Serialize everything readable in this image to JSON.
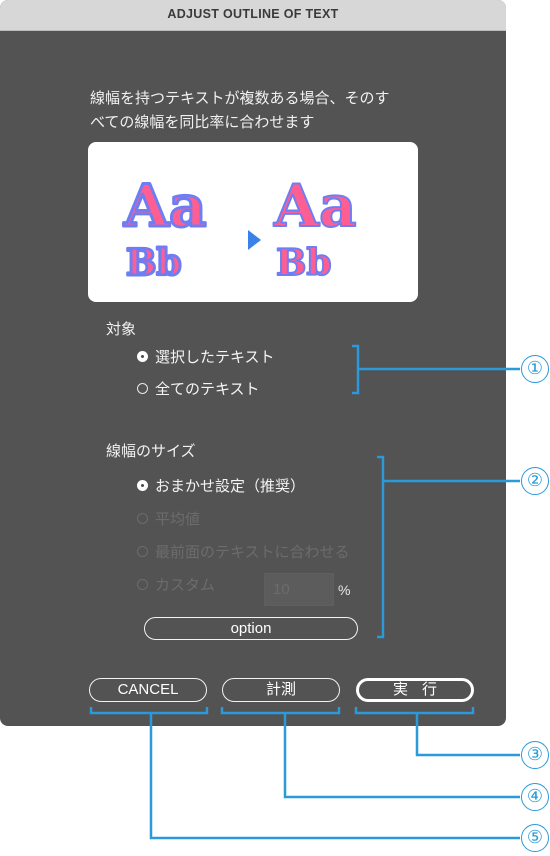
{
  "dialog": {
    "title": "ADJUST OUTLINE OF TEXT",
    "description_lines": [
      "線幅を持つテキストが複数ある場合、そのす",
      "べての線幅を同比率に合わせます"
    ],
    "preview": {
      "before": {
        "large": "Aa",
        "small": "Bb"
      },
      "after": {
        "large": "Aa",
        "small": "Bb"
      },
      "arrow_icon": "triangle-right",
      "fill_color": "#ff5e93",
      "stroke_color": "#6f7df2",
      "arrow_color": "#3a82ea"
    },
    "target": {
      "label": "対象",
      "options": [
        {
          "label": "選択したテキスト",
          "selected": true,
          "enabled": true
        },
        {
          "label": "全てのテキスト",
          "selected": false,
          "enabled": true
        }
      ]
    },
    "stroke_size": {
      "label": "線幅のサイズ",
      "options": [
        {
          "label": "おまかせ設定（推奨）",
          "selected": true,
          "enabled": true
        },
        {
          "label": "平均値",
          "selected": false,
          "enabled": false
        },
        {
          "label": "最前面のテキストに合わせる",
          "selected": false,
          "enabled": false
        },
        {
          "label": "カスタム",
          "selected": false,
          "enabled": false
        }
      ],
      "custom_value": "10",
      "unit": "%",
      "option_button": "option"
    },
    "buttons": {
      "cancel": "CANCEL",
      "measure": "計測",
      "execute": "実行"
    }
  },
  "annotations": {
    "color": "#2a9ad9",
    "callouts": [
      "①",
      "②",
      "③",
      "④",
      "⑤"
    ]
  }
}
